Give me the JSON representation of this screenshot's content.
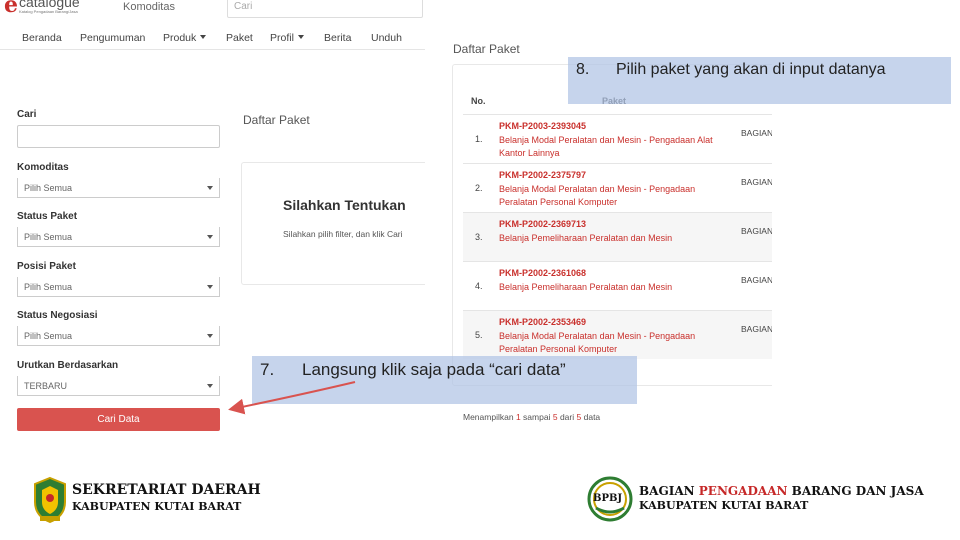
{
  "left_screen": {
    "logo": {
      "text": "catalogue",
      "subtext": "Katalog Pengadaan Barang/Jasa"
    },
    "top_label": "Komoditas",
    "search_placeholder": "Cari",
    "nav": [
      {
        "label": "Beranda",
        "has_caret": false
      },
      {
        "label": "Pengumuman",
        "has_caret": false
      },
      {
        "label": "Produk",
        "has_caret": true
      },
      {
        "label": "Paket",
        "has_caret": false
      },
      {
        "label": "Profil",
        "has_caret": true
      },
      {
        "label": "Berita",
        "has_caret": false
      },
      {
        "label": "Unduh",
        "has_caret": false
      }
    ],
    "filters": {
      "cari_label": "Cari",
      "komoditas": {
        "label": "Komoditas",
        "value": "Pilih Semua"
      },
      "status_paket": {
        "label": "Status Paket",
        "value": "Pilih Semua"
      },
      "posisi_paket": {
        "label": "Posisi Paket",
        "value": "Pilih Semua"
      },
      "status_negosiasi": {
        "label": "Status Negosiasi",
        "value": "Pilih Semua"
      },
      "urutkan": {
        "label": "Urutkan Berdasarkan",
        "value": "TERBARU"
      },
      "button": "Cari Data"
    },
    "panel": {
      "title": "Daftar Paket",
      "heading": "Silahkan Tentukan",
      "subtext": "Silahkan pilih filter, dan klik Cari"
    }
  },
  "right_screen": {
    "title": "Daftar Paket",
    "columns": [
      "No.",
      "Paket"
    ],
    "rows": [
      {
        "no": "1.",
        "code": "PKM-P2003-2393045",
        "desc": "Belanja Modal Peralatan dan Mesin - Pengadaan Alat Kantor Lainnya",
        "org": "BAGIAN BARANG"
      },
      {
        "no": "2.",
        "code": "PKM-P2002-2375797",
        "desc": "Belanja Modal Peralatan dan Mesin - Pengadaan Peralatan Personal Komputer",
        "org": "BAGIAN BARANG"
      },
      {
        "no": "3.",
        "code": "PKM-P2002-2369713",
        "desc": "Belanja Pemeliharaan Peralatan dan Mesin",
        "org": "BAGIAN BARANG"
      },
      {
        "no": "4.",
        "code": "PKM-P2002-2361068",
        "desc": "Belanja Pemeliharaan Peralatan dan Mesin",
        "org": "BAGIAN BARANG"
      },
      {
        "no": "5.",
        "code": "PKM-P2002-2353469",
        "desc": "Belanja Modal Peralatan dan Mesin - Pengadaan Peralatan Personal Komputer",
        "org": "BAGIAN BARANG"
      }
    ],
    "showing": {
      "prefix": "Menampilkan",
      "from": "1",
      "mid1": "sampai",
      "to": "5",
      "mid2": "dari",
      "total": "5",
      "suffix": "data"
    }
  },
  "callouts": {
    "step8": {
      "number": "8.",
      "text": "Pilih paket yang akan di input datanya"
    },
    "step7": {
      "number": "7.",
      "text": "Langsung klik saja pada “cari data”"
    }
  },
  "footer": {
    "left": {
      "title": "SEKRETARIAT DAERAH",
      "subtitle": "KABUPATEN KUTAI BARAT"
    },
    "right": {
      "badge": "BPBJ",
      "title_pre": "BAGIAN",
      "title_highlight": "PENGADAAN",
      "title_post": "BARANG DAN JASA",
      "subtitle": "KABUPATEN KUTAI BARAT"
    }
  },
  "colors": {
    "accent_red": "#d9534f",
    "link_red": "#c9302c",
    "callout_blue": "#b0c4e4",
    "gold": "#c8a000",
    "green": "#2e7d32"
  }
}
